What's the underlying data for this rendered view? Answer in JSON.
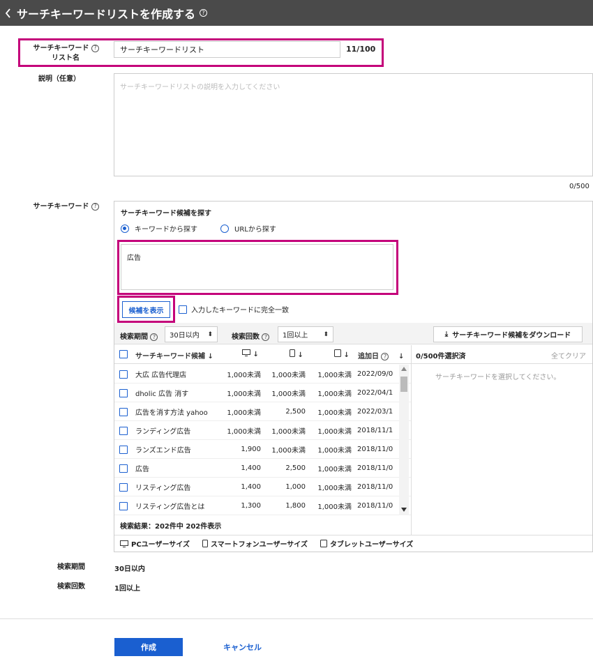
{
  "header": {
    "title": "サーチキーワードリストを作成する",
    "help": "?"
  },
  "form": {
    "list_name_label_1": "サーチキーワード",
    "list_name_label_2": "リスト名",
    "list_name_value": "サーチキーワードリスト",
    "list_name_count": "11/100",
    "desc_label": "説明（任意）",
    "desc_placeholder": "サーチキーワードリストの説明を入力してください",
    "desc_count": "0/500",
    "kw_label": "サーチキーワード"
  },
  "kw_panel": {
    "title": "サーチキーワード候補を探す",
    "radio_keyword": "キーワードから探す",
    "radio_url": "URLから探す",
    "keyword_text": "広告",
    "show_button": "候補を表示",
    "exact_match_label": "入力したキーワードに完全一致",
    "period_label": "検索期間",
    "period_value": "30日以内",
    "count_label": "検索回数",
    "count_value": "1回以上",
    "download_label": "サーチキーワード候補をダウンロード",
    "col_keyword": "サーチキーワード候補",
    "col_added": "追加日",
    "selected_count": "0/500件選択済",
    "clear_all": "全てクリア",
    "empty_message": "サーチキーワードを選択してください。",
    "result_text": "検索結果：202件中 202件表示",
    "legend_pc": "PCユーザーサイズ",
    "legend_sp": "スマートフォンユーザーサイズ",
    "legend_tab": "タブレットユーザーサイズ",
    "rows": [
      {
        "kw": "大広 広告代理店",
        "pc": "1,000未満",
        "sp": "1,000未満",
        "tab": "1,000未満",
        "date": "2022/09/0"
      },
      {
        "kw": "dholic 広告 消す",
        "pc": "1,000未満",
        "sp": "1,000未満",
        "tab": "1,000未満",
        "date": "2022/04/1"
      },
      {
        "kw": "広告を消す方法 yahoo",
        "pc": "1,000未満",
        "sp": "2,500",
        "tab": "1,000未満",
        "date": "2022/03/1"
      },
      {
        "kw": "ランディング広告",
        "pc": "1,000未満",
        "sp": "1,000未満",
        "tab": "1,000未満",
        "date": "2018/11/1"
      },
      {
        "kw": "ランズエンド広告",
        "pc": "1,900",
        "sp": "1,000未満",
        "tab": "1,000未満",
        "date": "2018/11/0"
      },
      {
        "kw": "広告",
        "pc": "1,400",
        "sp": "2,500",
        "tab": "1,000未満",
        "date": "2018/11/0"
      },
      {
        "kw": "リスティング広告",
        "pc": "1,400",
        "sp": "1,000",
        "tab": "1,000未満",
        "date": "2018/11/0"
      },
      {
        "kw": "リスティング広告とは",
        "pc": "1,300",
        "sp": "1,800",
        "tab": "1,000未満",
        "date": "2018/11/0"
      }
    ]
  },
  "summary": {
    "period_label": "検索期間",
    "period_value": "30日以内",
    "count_label": "検索回数",
    "count_value": "1回以上"
  },
  "buttons": {
    "create": "作成",
    "cancel": "キャンセル"
  }
}
